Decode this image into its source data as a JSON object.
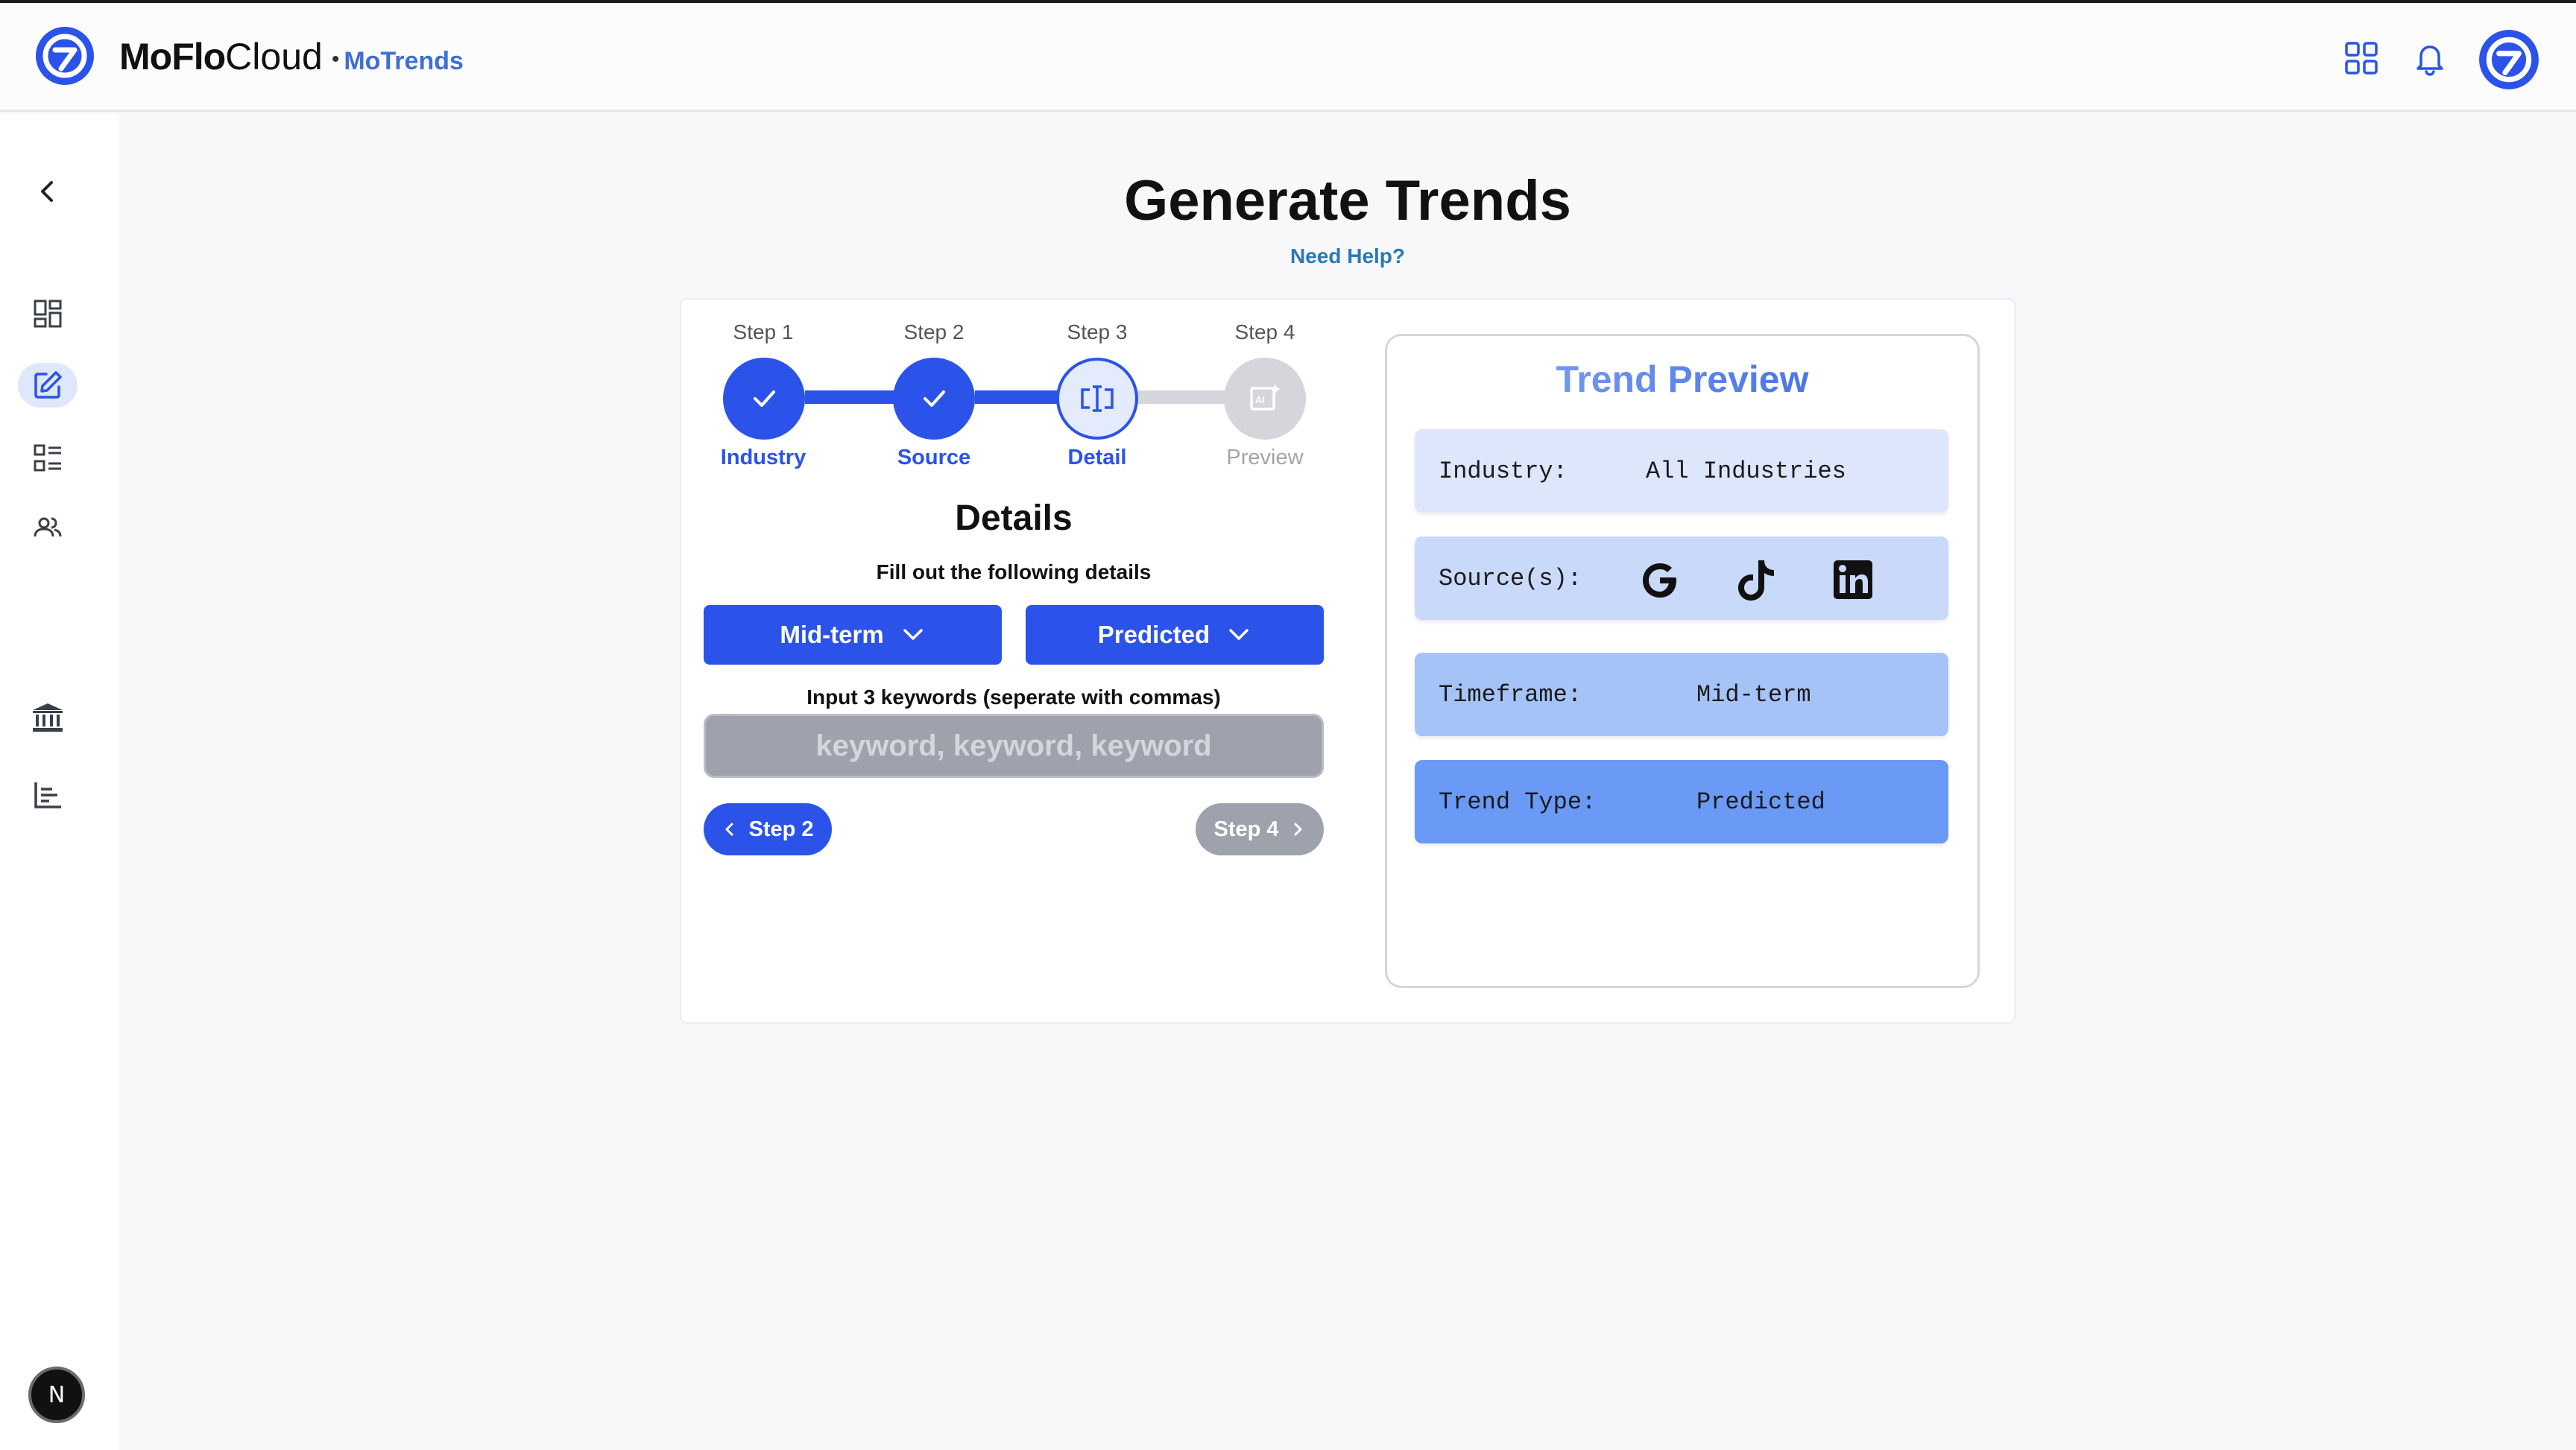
{
  "header": {
    "brand_bold": "MoFlo",
    "brand_light": "Cloud",
    "separator": "•",
    "app_name": "MoTrends",
    "icons": [
      "logo-icon",
      "apps-grid-icon",
      "bell-icon",
      "avatar-icon"
    ]
  },
  "sidebar": {
    "items": [
      {
        "name": "collapse",
        "icon": "chevron-left-icon"
      },
      {
        "name": "dashboard",
        "icon": "dashboard-icon"
      },
      {
        "name": "generate",
        "icon": "edit-icon",
        "active": true
      },
      {
        "name": "list",
        "icon": "list-icon"
      },
      {
        "name": "users",
        "icon": "users-icon"
      },
      {
        "name": "institution",
        "icon": "bank-icon"
      },
      {
        "name": "analytics",
        "icon": "chart-icon"
      }
    ],
    "bottom_badge": "N"
  },
  "page": {
    "title": "Generate Trends",
    "help_link": "Need Help?"
  },
  "stepper": {
    "steps": [
      {
        "label": "Step 1",
        "name": "Industry",
        "state": "complete"
      },
      {
        "label": "Step 2",
        "name": "Source",
        "state": "complete"
      },
      {
        "label": "Step 3",
        "name": "Detail",
        "state": "current"
      },
      {
        "label": "Step 4",
        "name": "Preview",
        "state": "upcoming"
      }
    ]
  },
  "details": {
    "title": "Details",
    "subtitle": "Fill out the following details",
    "timeframe_select": "Mid-term",
    "trend_type_select": "Predicted",
    "keywords_label": "Input 3 keywords (seperate with commas)",
    "keywords_placeholder": "keyword, keyword, keyword",
    "keywords_value": "",
    "back_button": "Step 2",
    "next_button": "Step 4"
  },
  "preview": {
    "title": "Trend Preview",
    "rows": [
      {
        "key": "Industry:",
        "value": "All Industries",
        "color": "#dde6fb"
      },
      {
        "key": "Source(s):",
        "value": "",
        "color": "#c9d9f9",
        "icons": [
          "google-icon",
          "tiktok-icon",
          "linkedin-icon"
        ]
      },
      {
        "key": "Timeframe:",
        "value": "Mid-term",
        "color": "#a6c3f8"
      },
      {
        "key": "Trend Type:",
        "value": "Predicted",
        "color": "#6a9af5"
      }
    ]
  },
  "colors": {
    "primary": "#2b53ea",
    "step_complete": "#2b53ea",
    "step_current_bg": "#e3ebfd",
    "step_upcoming": "#cfd1d6",
    "link": "#2a78b8",
    "disabled": "#9ea2ac"
  }
}
